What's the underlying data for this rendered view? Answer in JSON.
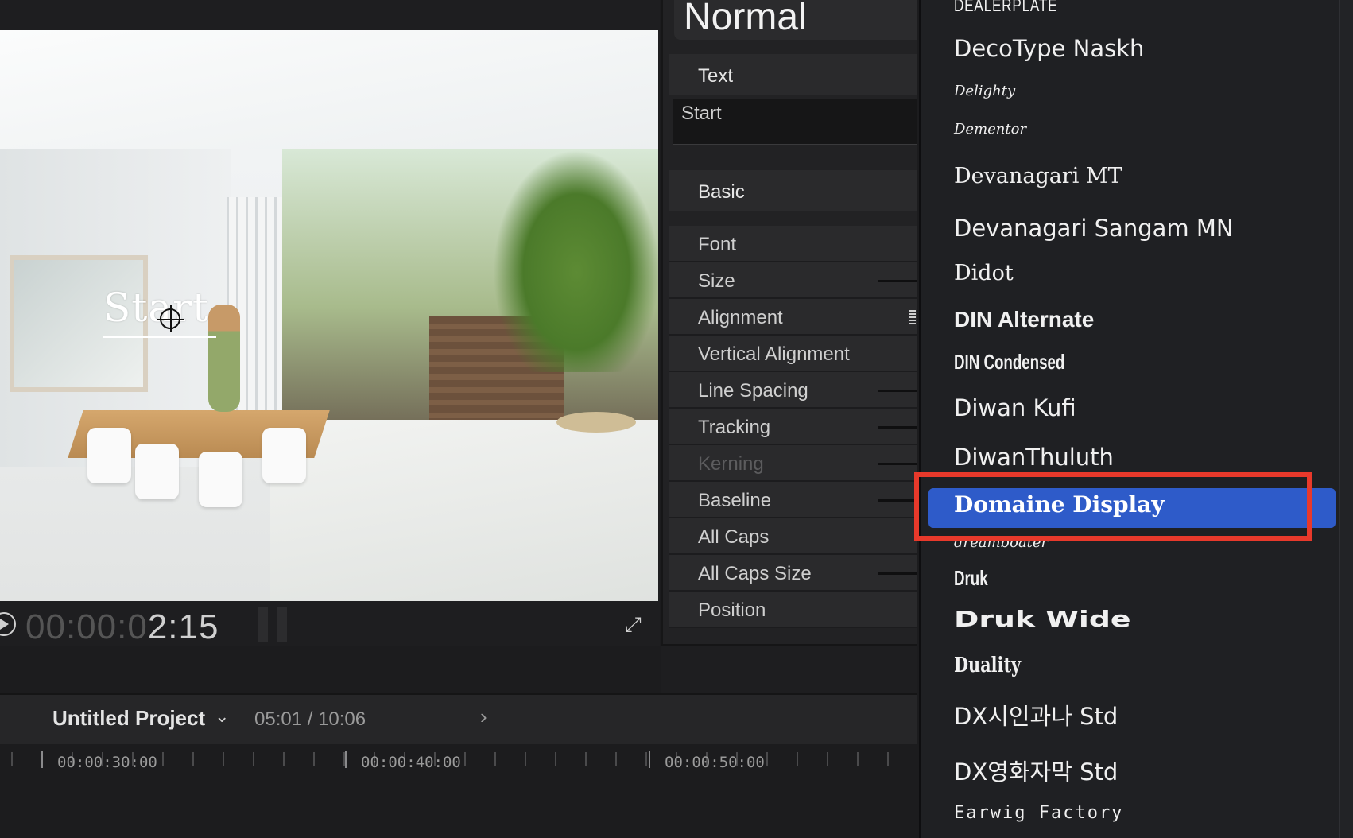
{
  "viewer": {
    "title_text": "Start",
    "timecode_dim": "00:00:0",
    "timecode_lit": "2:15"
  },
  "inspector": {
    "style_name": "Normal",
    "text_section": "Text",
    "text_value": "Start",
    "basic_section": "Basic",
    "params": [
      {
        "label": "Font",
        "control": "none",
        "enabled": true
      },
      {
        "label": "Size",
        "control": "slider",
        "enabled": true
      },
      {
        "label": "Alignment",
        "control": "align",
        "enabled": true
      },
      {
        "label": "Vertical Alignment",
        "control": "none",
        "enabled": true
      },
      {
        "label": "Line Spacing",
        "control": "slider",
        "enabled": true
      },
      {
        "label": "Tracking",
        "control": "slider",
        "enabled": true
      },
      {
        "label": "Kerning",
        "control": "slider",
        "enabled": false
      },
      {
        "label": "Baseline",
        "control": "slider",
        "enabled": true
      },
      {
        "label": "All Caps",
        "control": "none",
        "enabled": true
      },
      {
        "label": "All Caps Size",
        "control": "slider",
        "enabled": true
      },
      {
        "label": "Position",
        "control": "none",
        "enabled": true
      }
    ]
  },
  "timeline": {
    "project_name": "Untitled Project",
    "duration": "05:01 / 10:06",
    "ruler_labels": [
      "00:00:30:00",
      "00:00:40:00",
      "00:00:50:00"
    ]
  },
  "font_menu": {
    "selected": "Domaine Display",
    "items": [
      {
        "name": "DEALERPLATE",
        "style": "condensed-caps"
      },
      {
        "name": "DecoType Naskh",
        "style": "sans"
      },
      {
        "name": "Delighty",
        "style": "script"
      },
      {
        "name": "Dementor",
        "style": "script"
      },
      {
        "name": "Devanagari MT",
        "style": "serif"
      },
      {
        "name": "Devanagari Sangam MN",
        "style": "sans"
      },
      {
        "name": "Didot",
        "style": "serif"
      },
      {
        "name": "DIN Alternate",
        "style": "sans-bold"
      },
      {
        "name": "DIN Condensed",
        "style": "condensed-bold"
      },
      {
        "name": "Diwan Kufi",
        "style": "sans"
      },
      {
        "name": "DiwanThuluth",
        "style": "sans"
      },
      {
        "name": "Domaine Display",
        "style": "serif-bold"
      },
      {
        "name": "dreamboater",
        "style": "script"
      },
      {
        "name": "Druk",
        "style": "condensed-bold"
      },
      {
        "name": "Druk Wide",
        "style": "wide-black"
      },
      {
        "name": "Duality",
        "style": "serif-bold-condensed"
      },
      {
        "name": "DX시인과나 Std",
        "style": "sans"
      },
      {
        "name": "DX영화자막 Std",
        "style": "sans"
      },
      {
        "name": "Earwig Factory",
        "style": "ransom"
      }
    ]
  },
  "colors": {
    "selection": "#2e5bc9",
    "annotation": "#e8392b",
    "panel": "#2a2a2c"
  }
}
